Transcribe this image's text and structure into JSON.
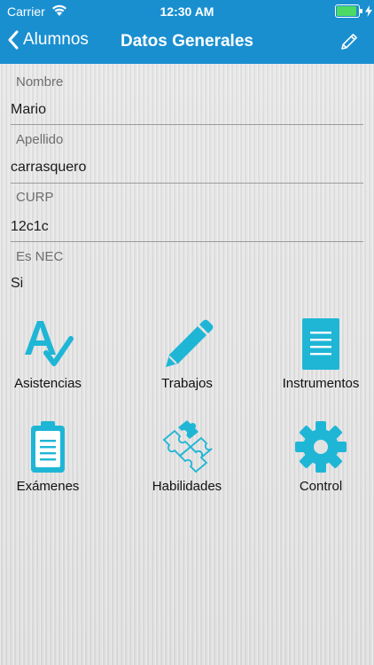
{
  "status_bar": {
    "carrier": "Carrier",
    "time": "12:30 AM"
  },
  "nav": {
    "back_label": "Alumnos",
    "title": "Datos Generales",
    "edit_icon": "pencil-icon"
  },
  "fields": [
    {
      "label": "Nombre",
      "value": "Mario"
    },
    {
      "label": "Apellido",
      "value": "carrasquero"
    },
    {
      "label": "CURP",
      "value": "12c1c"
    },
    {
      "label": "Es NEC",
      "value": "Si"
    }
  ],
  "tiles": [
    {
      "label": "Asistencias",
      "icon": "spellcheck-icon"
    },
    {
      "label": "Trabajos",
      "icon": "pencil-icon"
    },
    {
      "label": "Instrumentos",
      "icon": "document-icon"
    },
    {
      "label": "Exámenes",
      "icon": "clipboard-icon"
    },
    {
      "label": "Habilidades",
      "icon": "puzzle-icon"
    },
    {
      "label": "Control",
      "icon": "gear-icon"
    }
  ],
  "colors": {
    "nav_bar": "#1a8fd0",
    "icon_accent": "#1fb6d6",
    "battery": "#4cd964"
  }
}
